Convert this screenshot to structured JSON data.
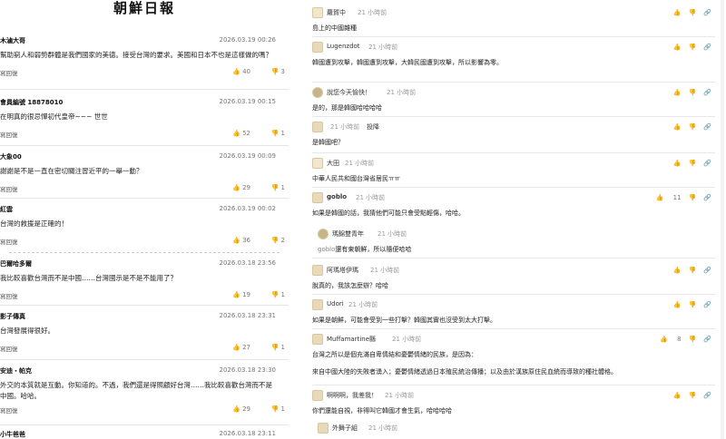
{
  "masthead": "朝鮮日報",
  "left_comments": [
    {
      "user": "木滷大哥",
      "date": "2026.03.19 00:26",
      "text": "幫助窮人和弱勢群體是我們國家的美德。接受台灣的要求。美國和日本不也是這樣做的嗎？",
      "reply": "寫回復",
      "likes": "40",
      "dislikes": "3"
    },
    {
      "user": "會員編號 18878010",
      "date": "2026.03.19 00:15",
      "text": "在明真的很忌憚初代皇帝~~~ 世世",
      "reply": "寫回復",
      "likes": "52",
      "dislikes": "1"
    },
    {
      "user": "大象00",
      "date": "2026.03.19 00:09",
      "text": "謝謝是不是一直在密切關注習近平的一舉一動？",
      "reply": "寫回復",
      "likes": "29",
      "dislikes": "1"
    },
    {
      "user": "紅雲",
      "date": "2026.03.19 00:02",
      "text": "台灣的救援是正確的！",
      "reply": "寫回復",
      "likes": "36",
      "dislikes": "2"
    },
    {
      "user": "巴爾哈多爾",
      "date": "2026.03.18 23:56",
      "text": "我比較喜歡台灣而不是中國……台灣國示是不是不能用了？",
      "reply": "寫回復",
      "likes": "19",
      "dislikes": "1"
    },
    {
      "user": "影子傳真",
      "date": "2026.03.18 23:31",
      "text": "台灣發展得很好。",
      "reply": "寫回復",
      "likes": "27",
      "dislikes": "1"
    },
    {
      "user": "安迪・帕克",
      "date": "2026.03.18 23:30",
      "text": "外交的本質就是互動。你知道的。不過，我們還是得照顧好台灣……我比較喜歡台灣而不是中國。哈哈。",
      "reply": "寫回復",
      "likes": "29",
      "dislikes": "1"
    },
    {
      "user": "小牛爸爸",
      "date": "2026.03.18 23:11",
      "text": "",
      "reply": "",
      "likes": "",
      "dislikes": ""
    }
  ],
  "right_comments": [
    {
      "user": "蘿賀中",
      "time": "21 小時前",
      "text": "島上的中國雜種",
      "avatar": "cat",
      "likes": "",
      "has_count": false
    },
    {
      "user": "Lugenzdot",
      "time": "21 小時前",
      "text": "韓國遭到攻擊，韓國遭到攻擊，大韓民國遭到攻擊，所以影響為零。",
      "avatar": "dog",
      "likes": "",
      "has_count": false
    },
    {
      "user": "說您今天愉快！",
      "time": "21 小時前",
      "text": "是的，那是韓國哈哈哈哈",
      "avatar": "round",
      "likes": "",
      "has_count": false
    },
    {
      "user": "",
      "time": "21 小時前",
      "text": "是韓國吧？",
      "avatar": "dog",
      "likes": "",
      "has_count": false,
      "extra": "投降"
    },
    {
      "user": "大田",
      "time": "21 小時前",
      "text": "中華人民共和國台灣省居民ㅠㅠ",
      "avatar": "cat",
      "likes": "",
      "has_count": false
    },
    {
      "user": "goblo",
      "time": "21 小時前",
      "text": "如果是韓國的話，我猜他們可能只會受點輕傷，哈哈。",
      "avatar": "dog",
      "likes": "11",
      "has_count": true
    },
    {
      "user": "阿瑪塔伊瑪",
      "time": "21 小時前",
      "text": "脫真的，我該怎麼辦？哈哈",
      "avatar": "dog",
      "likes": "",
      "has_count": false
    },
    {
      "user": "Udori",
      "time": "21 小時前",
      "text": "如果是朝鮮，可能會受到一些打擊？韓國其實也沒受到太大打擊。",
      "avatar": "dog",
      "likes": "",
      "has_count": false
    },
    {
      "user": "Muffamartine縣",
      "time": "21 小時前",
      "text": "台灣之所以是個充滿自卑情結和憂鬱情緒的民族，是因為：",
      "text2": "來自中國大陸的失敗者湧入；憂鬱情緒透過日本殖民統治傳播；以及由於漢族原住民血統而導致的種社體格。",
      "avatar": "dog",
      "likes": "8",
      "has_count": true
    },
    {
      "user": "啊啊啊，我差我！",
      "time": "21 小時前",
      "text": "你們還能自視，非得叫它韓國才會生氣，哈哈哈哈",
      "avatar": "dog",
      "likes": "",
      "has_count": false
    }
  ],
  "nested_replies": [
    {
      "user": "瑪錦雙青年",
      "time": "21 小時前",
      "mention": "goblo",
      "text": "還有東朝鮮，所以隨便哈哈"
    },
    {
      "user": "外舞子組",
      "time": "21 小時前",
      "text": ""
    }
  ],
  "icons": {
    "like": "👍",
    "dislike": "👎",
    "link": "🔗"
  }
}
